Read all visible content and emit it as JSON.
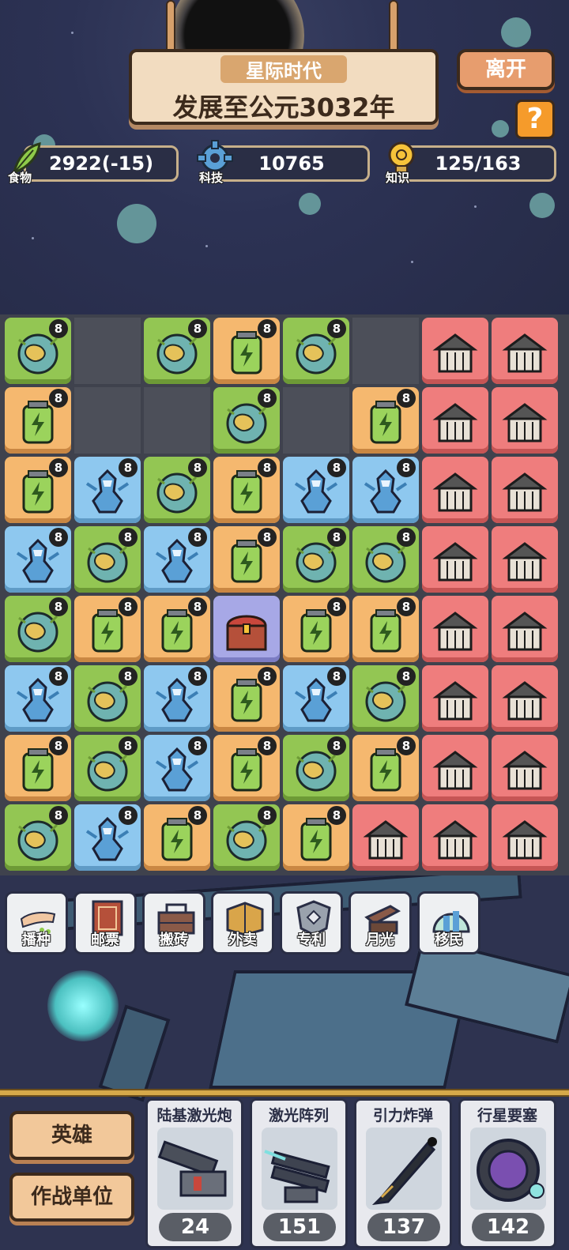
{
  "header": {
    "era_name": "星际时代",
    "era_description": "发展至公元3032年",
    "leave_label": "离开",
    "help_label": "?"
  },
  "resources": {
    "food": {
      "label": "食物",
      "value": "2922(-15)"
    },
    "tech": {
      "label": "科技",
      "value": "10765"
    },
    "knowledge": {
      "label": "知识",
      "value": "125/163"
    }
  },
  "grid": {
    "columns": 8,
    "rows": 8,
    "badge_value": "8",
    "cells": [
      [
        "green-planet",
        "empty",
        "green-planet",
        "orange-battery",
        "green-planet",
        "empty",
        "red-forbidden-city",
        "red-machu-picchu"
      ],
      [
        "orange-battery",
        "empty",
        "empty",
        "green-planet",
        "empty",
        "orange-battery",
        "red-colosseum",
        "red-zeus-statue"
      ],
      [
        "orange-battery",
        "blue-mecha",
        "green-planet",
        "orange-battery",
        "blue-mecha",
        "blue-mecha",
        "red-statue-of-liberty",
        "red-eiffel-tower"
      ],
      [
        "blue-mecha",
        "green-planet",
        "blue-mecha",
        "orange-battery",
        "green-planet",
        "green-planet",
        "red-stonehenge",
        "red-hanging-gardens"
      ],
      [
        "green-planet",
        "orange-battery",
        "orange-battery",
        "purple-treasure-chest",
        "orange-battery",
        "orange-battery",
        "red-chichen-itza",
        "red-lighthouse"
      ],
      [
        "blue-mecha",
        "green-planet",
        "blue-mecha",
        "orange-battery",
        "blue-mecha",
        "green-planet",
        "red-taj-mahal",
        "red-leaning-tower"
      ],
      [
        "orange-battery",
        "green-planet",
        "blue-mecha",
        "orange-battery",
        "green-planet",
        "orange-battery",
        "red-great-wall",
        "red-pyramid"
      ],
      [
        "green-planet",
        "blue-mecha",
        "orange-battery",
        "green-planet",
        "orange-battery",
        "red-terracotta-army",
        "red-scholar-statue",
        "red-temple"
      ]
    ]
  },
  "skills": [
    {
      "label": "播种",
      "icon": "sowing-hand-icon"
    },
    {
      "label": "邮票",
      "icon": "stamp-icon"
    },
    {
      "label": "搬砖",
      "icon": "brick-crate-icon"
    },
    {
      "label": "外卖",
      "icon": "delivery-box-icon"
    },
    {
      "label": "专利",
      "icon": "patent-badge-icon"
    },
    {
      "label": "月光",
      "icon": "moonlight-box-icon"
    },
    {
      "label": "移民",
      "icon": "migration-dome-icon"
    }
  ],
  "side_buttons": {
    "hero": "英雄",
    "combat_units": "作战单位"
  },
  "units": [
    {
      "name": "陆基激光炮",
      "count": "24",
      "icon": "laser-cannon-icon"
    },
    {
      "name": "激光阵列",
      "count": "151",
      "icon": "laser-array-icon"
    },
    {
      "name": "引力炸弹",
      "count": "137",
      "icon": "gravity-bomb-icon"
    },
    {
      "name": "行星要塞",
      "count": "142",
      "icon": "planet-fortress-icon"
    }
  ],
  "colors": {
    "background": "#2b3150",
    "green_tile": "#93c653",
    "orange_tile": "#f5b86f",
    "blue_tile": "#8ec8ef",
    "purple_tile": "#a7a8e6",
    "red_tile": "#ef7d7d",
    "sign_wood": "#f2dcc0"
  }
}
